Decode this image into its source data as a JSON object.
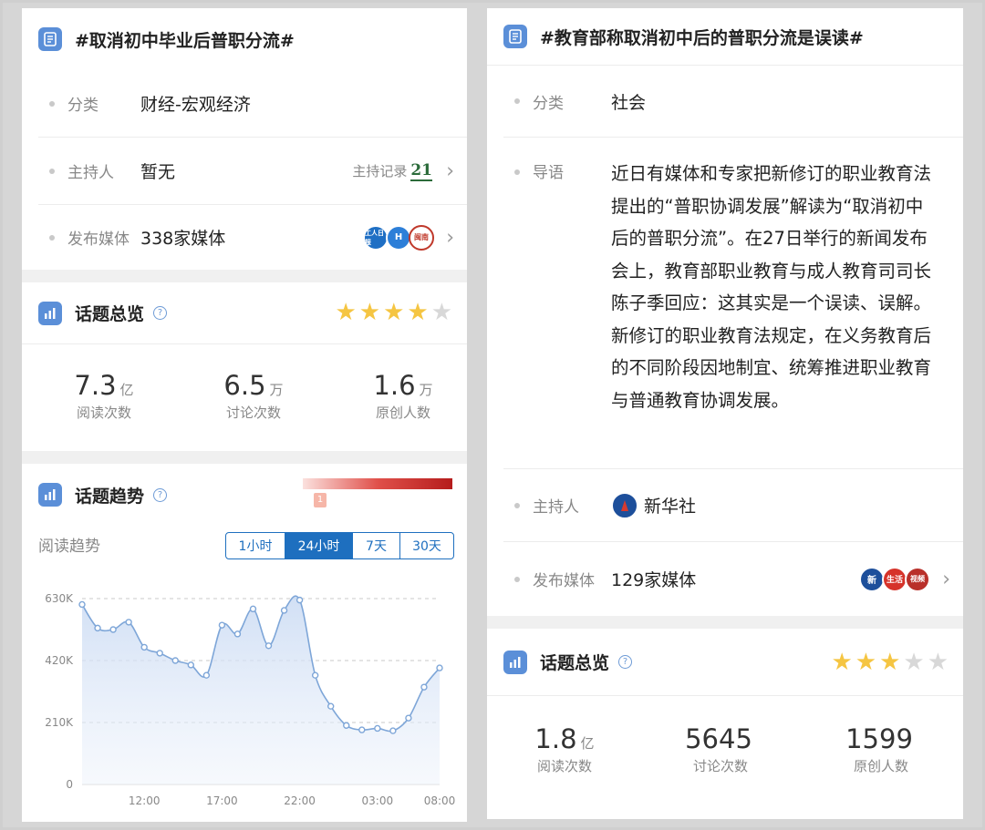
{
  "left": {
    "title": "#取消初中毕业后普职分流#",
    "category": {
      "label": "分类",
      "value": "财经-宏观经济"
    },
    "host": {
      "label": "主持人",
      "value": "暂无",
      "record_label": "主持记录",
      "record_badge": "21"
    },
    "media": {
      "label": "发布媒体",
      "value": "338家媒体",
      "logos": [
        "工人日报",
        "H",
        "闽南"
      ]
    },
    "overview": {
      "title": "话题总览",
      "rating": 4,
      "max_rating": 5,
      "stats": [
        {
          "num": "7.3",
          "unit": "亿",
          "caption": "阅读次数"
        },
        {
          "num": "6.5",
          "unit": "万",
          "caption": "讨论次数"
        },
        {
          "num": "1.6",
          "unit": "万",
          "caption": "原创人数"
        }
      ]
    },
    "trend": {
      "title": "话题趋势",
      "heat_marker": "1",
      "subtitle": "阅读趋势",
      "tabs": [
        "1小时",
        "24小时",
        "7天",
        "30天"
      ],
      "active_tab": "24小时"
    }
  },
  "right": {
    "title": "#教育部称取消初中后的普职分流是误读#",
    "category": {
      "label": "分类",
      "value": "社会"
    },
    "intro": {
      "label": "导语",
      "value": "近日有媒体和专家把新修订的职业教育法提出的“普职协调发展”解读为“取消初中后的普职分流”。在27日举行的新闻发布会上，教育部职业教育与成人教育司司长陈子季回应：这其实是一个误读、误解。新修订的职业教育法规定，在义务教育后的不同阶段因地制宜、统筹推进职业教育与普通教育协调发展。"
    },
    "host": {
      "label": "主持人",
      "value": "新华社"
    },
    "media": {
      "label": "发布媒体",
      "value": "129家媒体",
      "logos": [
        "新",
        "生活",
        "视频"
      ]
    },
    "overview": {
      "title": "话题总览",
      "rating": 3,
      "max_rating": 5,
      "stats": [
        {
          "num": "1.8",
          "unit": "亿",
          "caption": "阅读次数"
        },
        {
          "num": "5645",
          "unit": "",
          "caption": "讨论次数"
        },
        {
          "num": "1599",
          "unit": "",
          "caption": "原创人数"
        }
      ]
    }
  },
  "colors": {
    "accent": "#1e6fbf",
    "star_on": "#f5c542",
    "star_off": "#d8d8d8",
    "icon_bg": "#5b8fd8",
    "line": "#7ea6d8"
  },
  "chart_data": {
    "type": "area",
    "title": "",
    "xlabel": "",
    "ylabel": "",
    "x_ticks": [
      "12:00",
      "17:00",
      "22:00",
      "03:00",
      "08:00"
    ],
    "y_ticks": [
      "0",
      "210K",
      "420K",
      "630K"
    ],
    "ylim": [
      0,
      630000
    ],
    "grid": true,
    "series": [
      {
        "values": [
          610000,
          530000,
          525000,
          550000,
          465000,
          445000,
          420000,
          405000,
          370000,
          540000,
          510000,
          595000,
          470000,
          590000,
          625000,
          370000,
          265000,
          200000,
          185000,
          190000,
          182000,
          225000,
          330000,
          395000
        ]
      }
    ]
  }
}
